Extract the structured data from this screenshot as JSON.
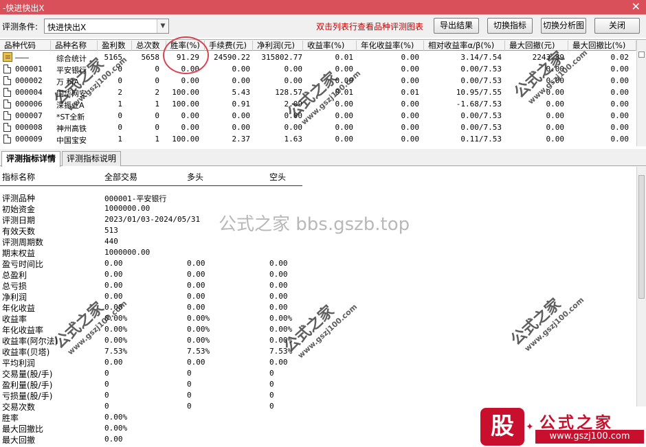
{
  "window": {
    "title": "-快进快出X",
    "close_glyph": "✕"
  },
  "toolbar": {
    "condition_label": "评测条件:",
    "condition_value": "快进快出X",
    "hint": "双击列表行查看品种评测图表",
    "buttons": {
      "export": "导出结果",
      "switch_indicator": "切换指标",
      "switch_chart": "切换分析图",
      "close": "关闭"
    }
  },
  "grid": {
    "columns": [
      "品种代码",
      "品种名称",
      "盈利数",
      "总次数",
      "胜率(%)",
      "手续费(元)",
      "净利润(元)",
      "收益率(%)",
      "年化收益率(%)",
      "相对收益率α/β(%)",
      "最大回撤(元)",
      "最大回撤比(%)"
    ],
    "rows": [
      {
        "icon": "summary-icon",
        "code": "———",
        "name": "综合统计",
        "wins": "5165",
        "total": "5658",
        "win_rate": "91.29",
        "fee": "24590.22",
        "net": "315802.77",
        "ret": "0.01",
        "annual": "0.00",
        "relative": "3.14/7.54",
        "max_dd": "2243.89",
        "max_dd_ratio": "0.02"
      },
      {
        "icon": "document-icon",
        "code": "000001",
        "name": "平安银行",
        "wins": "0",
        "total": "0",
        "win_rate": "0.00",
        "fee": "0.00",
        "net": "0.00",
        "ret": "0.00",
        "annual": "0.00",
        "relative": "0.00/7.53",
        "max_dd": "0.00",
        "max_dd_ratio": "0.00"
      },
      {
        "icon": "document-icon",
        "code": "000002",
        "name": "万 科A",
        "wins": "0",
        "total": "0",
        "win_rate": "0.00",
        "fee": "0.00",
        "net": "0.00",
        "ret": "0.00",
        "annual": "0.00",
        "relative": "0.00/7.53",
        "max_dd": "0.00",
        "max_dd_ratio": "0.00"
      },
      {
        "icon": "document-icon",
        "code": "000004",
        "name": "国华网安",
        "wins": "2",
        "total": "2",
        "win_rate": "100.00",
        "fee": "5.43",
        "net": "128.57",
        "ret": "0.01",
        "annual": "0.01",
        "relative": "10.95/7.55",
        "max_dd": "0.00",
        "max_dd_ratio": "0.00"
      },
      {
        "icon": "document-icon",
        "code": "000006",
        "name": "深振业A",
        "wins": "1",
        "total": "1",
        "win_rate": "100.00",
        "fee": "0.91",
        "net": "2.09",
        "ret": "0.00",
        "annual": "0.00",
        "relative": "-1.68/7.53",
        "max_dd": "0.00",
        "max_dd_ratio": "0.00"
      },
      {
        "icon": "document-icon",
        "code": "000007",
        "name": "*ST全新",
        "wins": "0",
        "total": "0",
        "win_rate": "0.00",
        "fee": "0.00",
        "net": "0.00",
        "ret": "0.00",
        "annual": "0.00",
        "relative": "0.00/7.53",
        "max_dd": "0.00",
        "max_dd_ratio": "0.00"
      },
      {
        "icon": "document-icon",
        "code": "000008",
        "name": "神州高铁",
        "wins": "0",
        "total": "0",
        "win_rate": "0.00",
        "fee": "0.00",
        "net": "0.00",
        "ret": "0.00",
        "annual": "0.00",
        "relative": "0.00/7.53",
        "max_dd": "0.00",
        "max_dd_ratio": "0.00"
      },
      {
        "icon": "document-icon",
        "code": "000009",
        "name": "中国宝安",
        "wins": "1",
        "total": "1",
        "win_rate": "100.00",
        "fee": "2.37",
        "net": "1.63",
        "ret": "0.00",
        "annual": "0.00",
        "relative": "0.11/7.53",
        "max_dd": "0.00",
        "max_dd_ratio": "0.00"
      }
    ]
  },
  "tabs": [
    {
      "label": "评测指标详情",
      "active": true
    },
    {
      "label": "评测指标说明",
      "active": false
    }
  ],
  "detail": {
    "headers": [
      "指标名称",
      "全部交易",
      "多头",
      "空头"
    ],
    "rows": [
      {
        "label": "评测品种",
        "all": "000001-平安银行",
        "long": "",
        "short": ""
      },
      {
        "label": "初始资金",
        "all": "1000000.00",
        "long": "",
        "short": ""
      },
      {
        "label": "评测日期",
        "all": "2023/01/03-2024/05/31",
        "long": "",
        "short": ""
      },
      {
        "label": "有效天数",
        "all": "513",
        "long": "",
        "short": ""
      },
      {
        "label": "评测周期数",
        "all": "440",
        "long": "",
        "short": ""
      },
      {
        "label": "期末权益",
        "all": "1000000.00",
        "long": "",
        "short": ""
      },
      {
        "label": "盈亏时间比",
        "all": "0.00",
        "long": "0.00",
        "short": "0.00"
      },
      {
        "label": "总盈利",
        "all": "0.00",
        "long": "0.00",
        "short": "0.00"
      },
      {
        "label": "总亏损",
        "all": "0.00",
        "long": "0.00",
        "short": "0.00"
      },
      {
        "label": "净利润",
        "all": "0.00",
        "long": "0.00",
        "short": "0.00"
      },
      {
        "label": "年化收益",
        "all": "0.00",
        "long": "0.00",
        "short": "0.00"
      },
      {
        "label": "收益率",
        "all": "0.00%",
        "long": "0.00%",
        "short": "0.00%"
      },
      {
        "label": "年化收益率",
        "all": "0.00%",
        "long": "0.00%",
        "short": "0.00%"
      },
      {
        "label": "收益率(阿尔法)",
        "all": "0.00%",
        "long": "0.00%",
        "short": "0.00%"
      },
      {
        "label": "收益率(贝塔)",
        "all": "7.53%",
        "long": "7.53%",
        "short": "7.53%"
      },
      {
        "label": "平均利润",
        "all": "0.00",
        "long": "0.00",
        "short": "0.00"
      },
      {
        "label": "交易量(股/手)",
        "all": "0",
        "long": "0",
        "short": "0"
      },
      {
        "label": "盈利量(股/手)",
        "all": "0",
        "long": "0",
        "short": "0"
      },
      {
        "label": "亏损量(股/手)",
        "all": "0",
        "long": "0",
        "short": "0"
      },
      {
        "label": "交易次数",
        "all": "0",
        "long": "0",
        "short": "0"
      },
      {
        "label": "胜率",
        "all": "0.00%",
        "long": "",
        "short": ""
      },
      {
        "label": "最大回撤比",
        "all": "0.00%",
        "long": "",
        "short": ""
      },
      {
        "label": "最大回撤",
        "all": "0.00",
        "long": "",
        "short": ""
      }
    ]
  },
  "watermarks": {
    "center_text": "公式之家 bbs.gszb.top",
    "stamp_big": "公式之家",
    "stamp_small": "www.gszj100.com"
  },
  "logo": {
    "badge": "股",
    "name": "公式之家",
    "url": "www.gszj100.com"
  },
  "colors": {
    "titlebar": "#d94f5a",
    "hint": "#c00000",
    "highlight_circle": "#d9434d",
    "logo_red": "#c8102e"
  }
}
